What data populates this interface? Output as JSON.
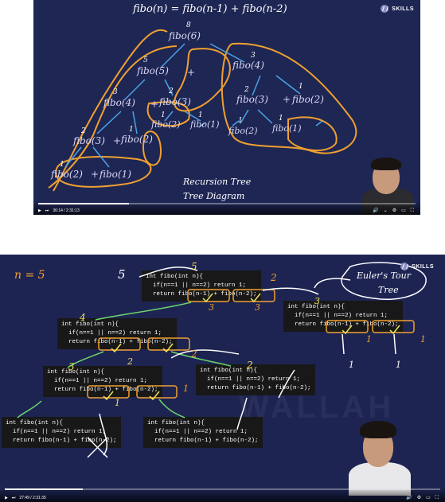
{
  "colors": {
    "board_bg": "#1e2654",
    "orange_ink": "#f0a030",
    "blue_ink": "#4aa3e8",
    "yellow_ink": "#f1e25a",
    "green_ink": "#6cd46c",
    "code_bg": "#181818"
  },
  "top_video": {
    "logo_text": "SKILLS",
    "formula": "fibo(n) = fibo(n-1) + fibo(n-2)",
    "nodes": {
      "n6": "fibo(6)",
      "n5": "fibo(5)",
      "plus_top": "+",
      "n4r": "fibo(4)",
      "n4l": "fibo(4)",
      "plus_l1": "+",
      "n3a": "fibo(3)",
      "n3r": "fibo(3)",
      "plus_r1": "+",
      "n2r": "fibo(2)",
      "n2a": "fibo(2)",
      "n1a": "fibo(1)",
      "n3b": "fibo(3)",
      "plus_l2": "+",
      "n2b": "fibo(2)",
      "n2c": "fibo(2)",
      "n1c": "fibo(1)",
      "n2d": "fibo(2)",
      "plus_l3": "+",
      "n1d": "fibo(1)"
    },
    "return_vals": {
      "r8": "8",
      "r5": "5",
      "r3a": "3",
      "r3b": "3",
      "r2a": "2",
      "r2b": "2",
      "r1a": "1",
      "r1b": "1",
      "r1c": "1",
      "r1d": "1",
      "r1e": "1",
      "r1f": "1",
      "r2c": "2",
      "r1g": "1"
    },
    "caption_1": "Recursion Tree",
    "caption_2": "Tree Diagram",
    "time": "36:14 / 2:31:13",
    "progress": 0.24,
    "icons": [
      "play-icon",
      "next-icon",
      "volume-icon",
      "chevron-down-icon",
      "settings-icon",
      "theater-icon",
      "fullscreen-icon"
    ]
  },
  "bottom_video": {
    "logo_text": "SKILLS",
    "n_label": "n = 5",
    "result_label": "5",
    "note_1": "Euler's Tour",
    "note_2": "Tree",
    "code_blocks": [
      {
        "lines": [
          "int fibo(int n){",
          "  if(n==1 || n==2) return 1;",
          "  return fibo(n-1) + fibo(n-2);"
        ]
      },
      {
        "lines": [
          "int fibo(int n){",
          "  if(n==1 || n==2) return 1;",
          "  return fibo(n-1) + fibo(n-2);"
        ]
      },
      {
        "lines": [
          "int fibo(int n){",
          "  if(n==1 || n==2) return 1;",
          "  return fibo(n-1) + fibo(n-2);"
        ]
      },
      {
        "lines": [
          "int fibo(int n){",
          "  if(n==1 || n==2) return 1;",
          "  return fibo(n-1) + fibo(n-2);"
        ]
      },
      {
        "lines": [
          "int fibo(int n){",
          "  if(n==1 || n==2) return 1;",
          "  return fibo(n-1) + fibo(n-2);"
        ]
      },
      {
        "lines": [
          "int fibo(int n){",
          "  if(n==1 || n==2) return 1;",
          "  return fibo(n-1) + fibo(n-2);"
        ]
      },
      {
        "lines": [
          "int fibo(int n){",
          "  if(n==1 || n==2) return 1;",
          "  return fibo(n-1) + fibo(n-2);"
        ]
      }
    ],
    "annot": {
      "a5": "5",
      "a4": "4",
      "a3": "3",
      "a2a": "2",
      "a2b": "2",
      "a2c": "2",
      "a3b": "3",
      "a2d": "2",
      "a1a": "1",
      "a1b": "1",
      "a1c": "1",
      "a1d": "1",
      "a1e": "1",
      "a1f": "1",
      "a3c": "3",
      "a3d": "3"
    },
    "time": "27:49 / 2:31:35",
    "progress": 0.18,
    "icons": [
      "play-icon",
      "next-icon",
      "volume-icon",
      "settings-icon",
      "theater-icon",
      "fullscreen-icon"
    ]
  }
}
